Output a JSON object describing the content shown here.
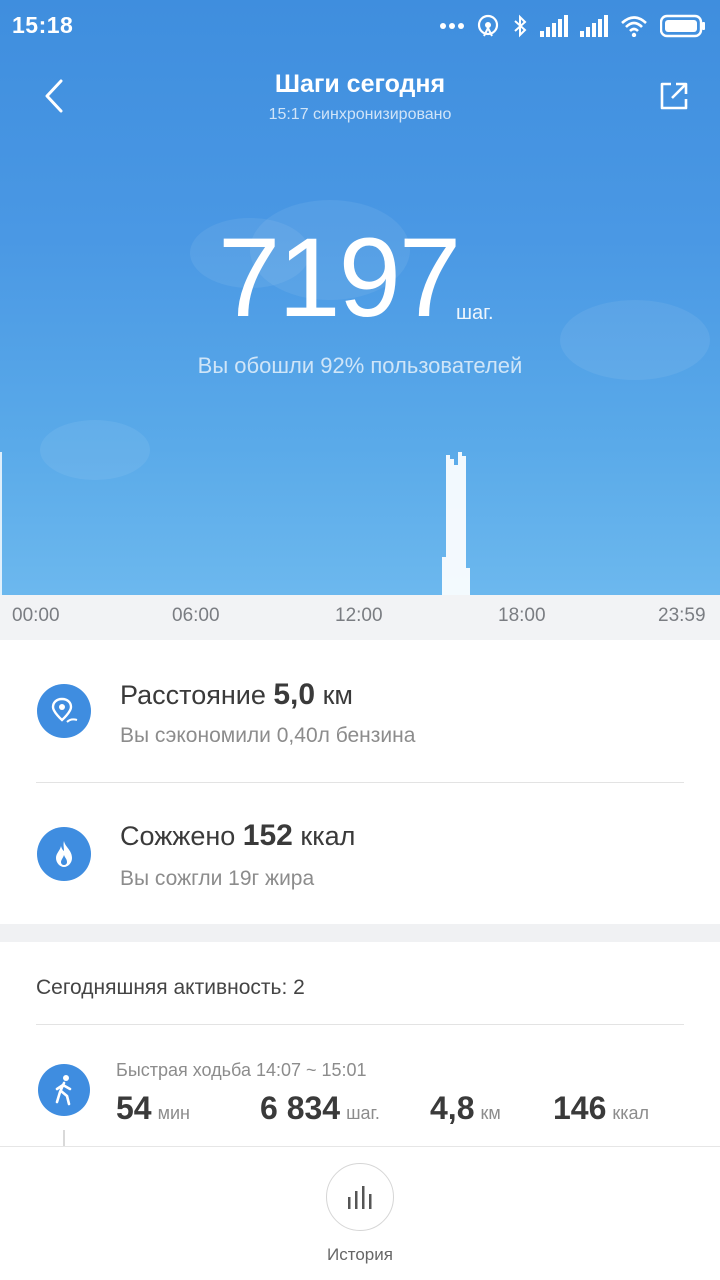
{
  "status": {
    "time": "15:18"
  },
  "header": {
    "title": "Шаги сегодня",
    "sync": "15:17 синхронизировано"
  },
  "summary": {
    "steps": "7197",
    "unit": "шаг.",
    "rank": "Вы обошли 92% пользователей"
  },
  "chart_data": {
    "type": "bar",
    "x_range": [
      "00:00",
      "23:59"
    ],
    "xticks": [
      "00:00",
      "06:00",
      "12:00",
      "18:00",
      "23:59"
    ],
    "bars": [
      {
        "time": "14:48",
        "level": 0.27
      },
      {
        "time": "14:56",
        "level": 1.0
      },
      {
        "time": "15:04",
        "level": 0.97
      },
      {
        "time": "15:12",
        "level": 0.93
      },
      {
        "time": "15:20",
        "level": 1.02
      },
      {
        "time": "15:28",
        "level": 0.99
      },
      {
        "time": "15:36",
        "level": 0.19
      }
    ]
  },
  "stats": {
    "distance": {
      "label": "Расстояние",
      "value": "5,0",
      "unit": "км",
      "note": "Вы сэкономили 0,40л бензина"
    },
    "calories": {
      "label": "Сожжено",
      "value": "152",
      "unit": "ккал",
      "note": "Вы сожгли 19г жира"
    }
  },
  "activity": {
    "header": "Сегодняшняя активность:  2",
    "item": {
      "title": "Быстрая ходьба 14:07 ~ 15:01",
      "duration": "54",
      "duration_unit": "мин",
      "steps": "6 834",
      "steps_unit": "шаг.",
      "distance": "4,8",
      "distance_unit": "км",
      "calories": "146",
      "calories_unit": "ккал"
    }
  },
  "bottom": {
    "history_label": "История"
  },
  "colors": {
    "hero_top": "#3f8ede",
    "hero_bottom": "#6cb8ee",
    "accent": "#3f8de0"
  }
}
